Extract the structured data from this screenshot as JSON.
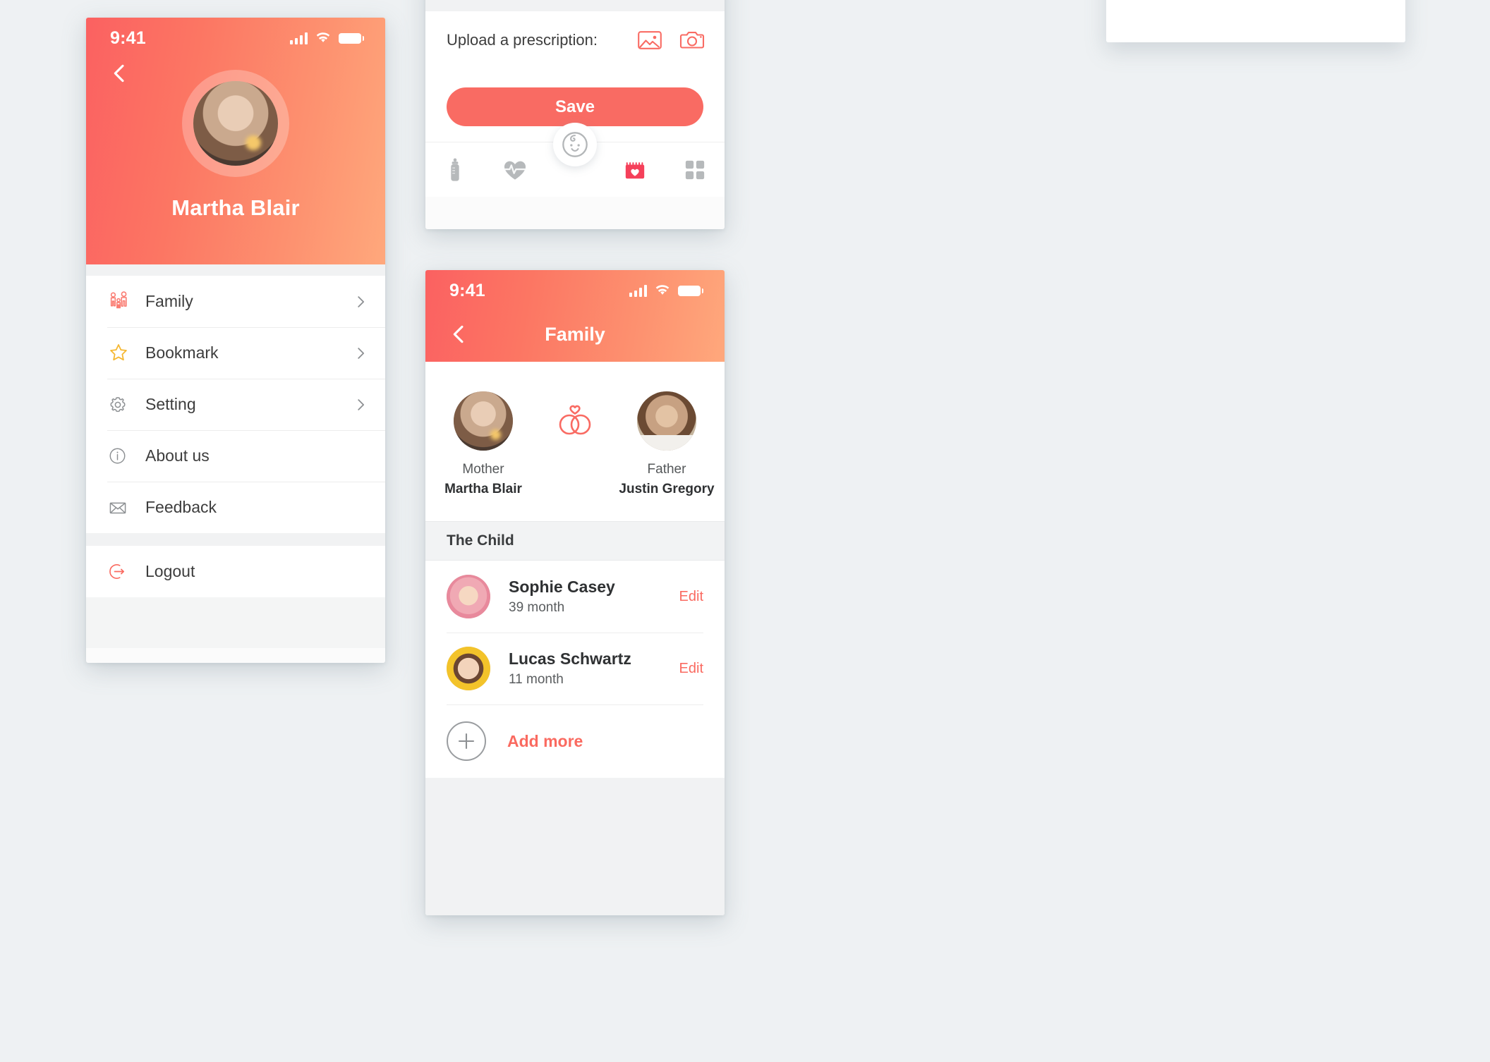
{
  "meta": {
    "accent": "#f96b63",
    "accent_light": "#fa6a60",
    "bookmark_yellow": "#f5b731",
    "grad_from": "#fb6161",
    "grad_to": "#ffa87c",
    "page_bg": "#eef1f3"
  },
  "profile_screen": {
    "status": {
      "time": "9:41",
      "signal_icon": "signal-bars-icon",
      "wifi_icon": "wifi-icon",
      "battery_icon": "battery-icon"
    },
    "back_icon": "chevron-left-icon",
    "avatar_icon": "avatar",
    "user_name": "Martha Blair",
    "menu": [
      {
        "label": "Family",
        "icon": "family-icon",
        "chevron": true
      },
      {
        "label": "Bookmark",
        "icon": "star-icon",
        "chevron": true
      },
      {
        "label": "Setting",
        "icon": "gear-icon",
        "chevron": true
      },
      {
        "label": "About us",
        "icon": "info-icon",
        "chevron": false
      },
      {
        "label": "Feedback",
        "icon": "envelope-icon",
        "chevron": false
      }
    ],
    "logout": {
      "label": "Logout",
      "icon": "logout-icon"
    }
  },
  "upload_screen": {
    "upload_label": "Upload a prescription:",
    "gallery_icon": "image-icon",
    "camera_icon": "camera-icon",
    "save_label": "Save",
    "tabbar": [
      {
        "icon": "baby-bottle-icon",
        "active": false
      },
      {
        "icon": "heartbeat-icon",
        "active": false
      },
      {
        "icon": "baby-face-icon",
        "active": false,
        "center": true
      },
      {
        "icon": "calendar-heart-icon",
        "active": true
      },
      {
        "icon": "grid-icon",
        "active": false
      }
    ]
  },
  "family_screen": {
    "status": {
      "time": "9:41",
      "signal_icon": "signal-bars-icon",
      "wifi_icon": "wifi-icon",
      "battery_icon": "battery-icon"
    },
    "back_icon": "chevron-left-icon",
    "title": "Family",
    "rings_icon": "wedding-rings-heart-icon",
    "parents": [
      {
        "role": "Mother",
        "name": "Martha Blair",
        "avatar": "mother-avatar"
      },
      {
        "role": "Father",
        "name": "Justin Gregory",
        "avatar": "father-avatar"
      }
    ],
    "children_section_title": "The Child",
    "children": [
      {
        "name": "Sophie Casey",
        "age": "39 month",
        "edit_label": "Edit",
        "avatar": "sophie-avatar"
      },
      {
        "name": "Lucas Schwartz",
        "age": "11 month",
        "edit_label": "Edit",
        "avatar": "lucas-avatar"
      }
    ],
    "add_more": {
      "label": "Add more",
      "icon": "plus-circle-icon"
    }
  },
  "tabbar_fragment": {
    "tabbar": [
      {
        "icon": "baby-bottle-icon",
        "active": false
      },
      {
        "icon": "heartbeat-icon",
        "active": false
      },
      {
        "icon": "baby-face-icon",
        "active": false,
        "center": true
      },
      {
        "icon": "calendar-heart-icon",
        "active": false
      },
      {
        "icon": "grid-icon",
        "active": true
      }
    ]
  }
}
